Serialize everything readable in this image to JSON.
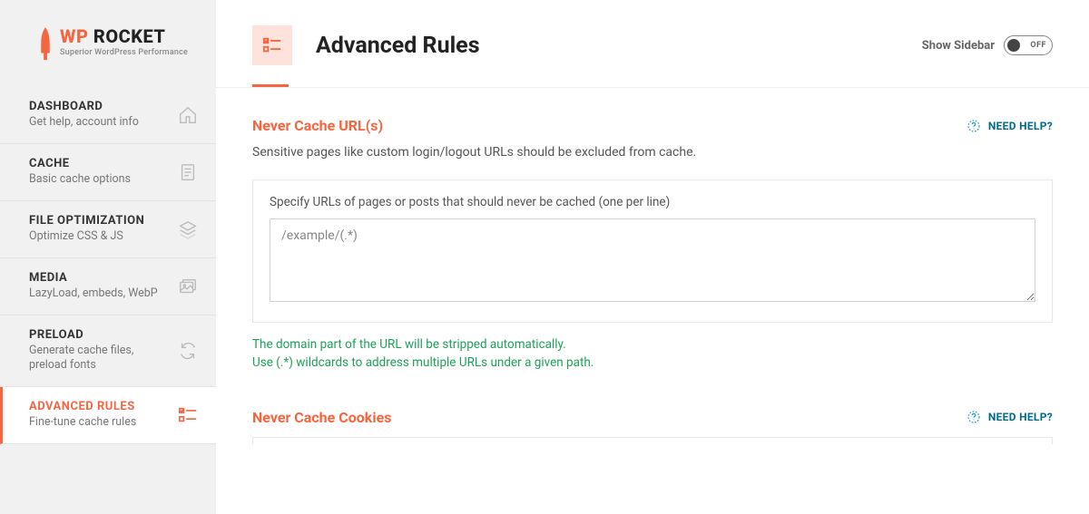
{
  "logo": {
    "wp": "WP",
    "rocket": "ROCKET",
    "subtitle": "Superior WordPress Performance"
  },
  "nav": [
    {
      "title": "DASHBOARD",
      "desc": "Get help, account info",
      "icon": "home"
    },
    {
      "title": "CACHE",
      "desc": "Basic cache options",
      "icon": "file"
    },
    {
      "title": "FILE OPTIMIZATION",
      "desc": "Optimize CSS & JS",
      "icon": "layers"
    },
    {
      "title": "MEDIA",
      "desc": "LazyLoad, embeds, WebP",
      "icon": "images"
    },
    {
      "title": "PRELOAD",
      "desc": "Generate cache files, preload fonts",
      "icon": "refresh"
    },
    {
      "title": "ADVANCED RULES",
      "desc": "Fine-tune cache rules",
      "icon": "list-check",
      "active": true
    }
  ],
  "header": {
    "title": "Advanced Rules",
    "sidebarLabel": "Show Sidebar",
    "toggleText": "OFF"
  },
  "sections": [
    {
      "title": "Never Cache URL(s)",
      "help": "NEED HELP?",
      "desc": "Sensitive pages like custom login/logout URLs should be excluded from cache.",
      "fieldLabel": "Specify URLs of pages or posts that should never be cached (one per line)",
      "placeholder": "/example/(.*)",
      "hint1": "The domain part of the URL will be stripped automatically.",
      "hint2": "Use (.*) wildcards to address multiple URLs under a given path."
    },
    {
      "title": "Never Cache Cookies",
      "help": "NEED HELP?"
    }
  ]
}
